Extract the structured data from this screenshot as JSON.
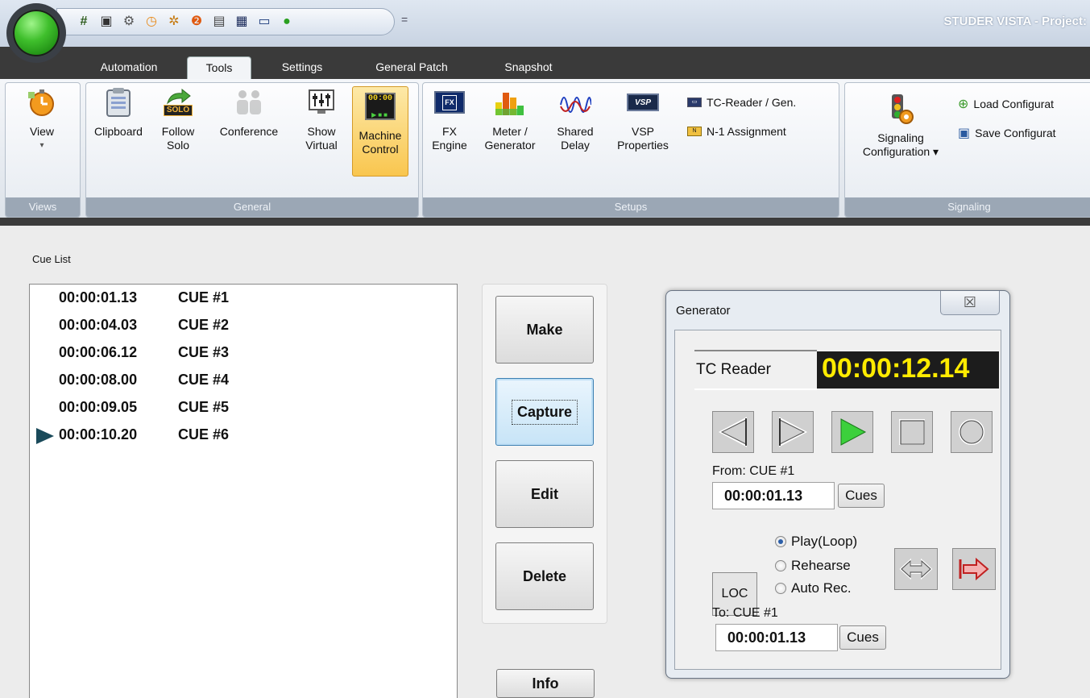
{
  "titlebar": {
    "app_title": "STUDER VISTA - Project:",
    "quick_access_icons": [
      "grid-icon",
      "camera-icon",
      "routing-icon",
      "clock-icon",
      "settings-wheel-icon",
      "help-icon",
      "clipboard-icon",
      "fx-icon",
      "panel-icon",
      "green-dot-icon"
    ],
    "overflow": "="
  },
  "tabs": [
    {
      "label": "Automation",
      "active": false
    },
    {
      "label": "Tools",
      "active": true
    },
    {
      "label": "Settings",
      "active": false
    },
    {
      "label": "General Patch",
      "active": false
    },
    {
      "label": "Snapshot",
      "active": false
    }
  ],
  "ribbon": {
    "groups": {
      "views": "Views",
      "general": "General",
      "setups": "Setups",
      "signaling": "Signaling"
    },
    "view": {
      "line1": "View",
      "dropdown": "▾"
    },
    "clipboard": {
      "line1": "Clipboard"
    },
    "follow_solo": {
      "line1": "Follow",
      "line2": "Solo",
      "badge": "SOLO"
    },
    "conference": {
      "line1": "Conference"
    },
    "show_virtual": {
      "line1": "Show",
      "line2": "Virtual"
    },
    "machine_control": {
      "line1": "Machine",
      "line2": "Control",
      "badge": "00:00",
      "active": true
    },
    "fx_engine": {
      "line1": "FX",
      "line2": "Engine",
      "badge": "FX"
    },
    "meter_generator": {
      "line1": "Meter /",
      "line2": "Generator"
    },
    "shared_delay": {
      "line1": "Shared",
      "line2": "Delay"
    },
    "vsp_properties": {
      "line1": "VSP",
      "line2": "Properties",
      "badge": "VSP"
    },
    "tc_reader_gen": {
      "label": "TC-Reader / Gen."
    },
    "n1_assignment": {
      "label": "N-1 Assignment"
    },
    "signaling_config": {
      "line1": "Signaling",
      "line2": "Configuration ▾"
    },
    "load_config": {
      "label": "Load Configurat"
    },
    "save_config": {
      "label": "Save Configurat"
    }
  },
  "cue_list": {
    "title": "Cue List",
    "rows": [
      {
        "time": "00:00:01.13",
        "name": "CUE #1",
        "current": false
      },
      {
        "time": "00:00:04.03",
        "name": "CUE #2",
        "current": false
      },
      {
        "time": "00:00:06.12",
        "name": "CUE #3",
        "current": false
      },
      {
        "time": "00:00:08.00",
        "name": "CUE #4",
        "current": false
      },
      {
        "time": "00:00:09.05",
        "name": "CUE #5",
        "current": false
      },
      {
        "time": "00:00:10.20",
        "name": "CUE #6",
        "current": true
      }
    ]
  },
  "actions": {
    "make": "Make",
    "capture": "Capture",
    "edit": "Edit",
    "delete": "Delete",
    "info": "Info"
  },
  "generator": {
    "title": "Generator",
    "close": "☒",
    "tc_label": "TC Reader",
    "tc_value": "00:00:12.14",
    "from_label": "From: CUE #1",
    "from_value": "00:00:01.13",
    "to_label": "To: CUE #1",
    "to_value": "00:00:01.13",
    "cues_label": "Cues",
    "loc_label": "LOC",
    "modes": [
      {
        "label": "Play(Loop)",
        "selected": true
      },
      {
        "label": "Rehearse",
        "selected": false
      },
      {
        "label": "Auto Rec.",
        "selected": false
      }
    ]
  }
}
